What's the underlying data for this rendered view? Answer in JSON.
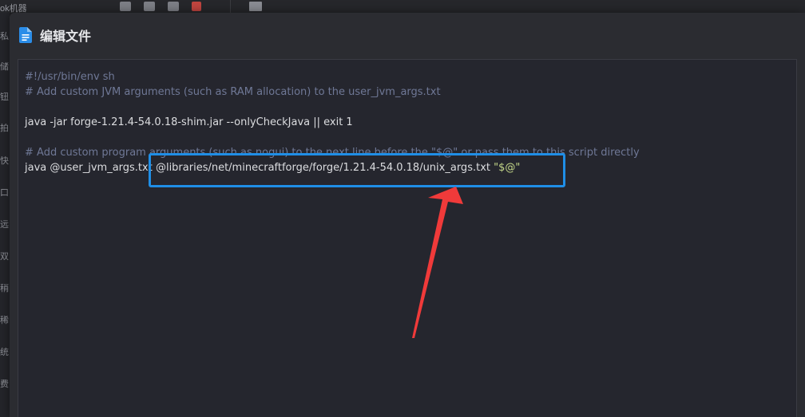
{
  "background": {
    "app_title": "ok机器",
    "toolbar_icons": [
      "folder-plus-icon",
      "file-plus-icon",
      "file-download-icon",
      "trash-icon"
    ],
    "monitor_icon": "monitor-icon",
    "sidebar_fragments": [
      "私",
      "储",
      "钮",
      "拍",
      "快",
      "口",
      "远",
      "双",
      "稍",
      "稀",
      "统",
      "费"
    ]
  },
  "dialog": {
    "icon": "document-icon",
    "title": "编辑文件",
    "accent_color": "#1f8ee6"
  },
  "editor": {
    "lines": [
      {
        "type": "comment",
        "text": "#!/usr/bin/env sh"
      },
      {
        "type": "comment",
        "text": "# Add custom JVM arguments (such as RAM allocation) to the user_jvm_args.txt"
      },
      {
        "type": "blank",
        "text": ""
      },
      {
        "type": "code",
        "text": "java -jar forge-1.21.4-54.0.18-shim.jar --onlyCheckJava || exit 1"
      },
      {
        "type": "blank",
        "text": ""
      },
      {
        "type": "comment",
        "text": "# Add custom program arguments (such as nogui) to the next line before the \"$@\" or pass them to this script directly"
      },
      {
        "type": "code",
        "text": "java @user_jvm_args.txt @libraries/net/minecraftforge/forge/1.21.4-54.0.18/unix_args.txt ",
        "string": "\"$@\""
      }
    ]
  },
  "annotation": {
    "box_color": "#1f8ee6",
    "arrow_color": "#f03a3a"
  }
}
